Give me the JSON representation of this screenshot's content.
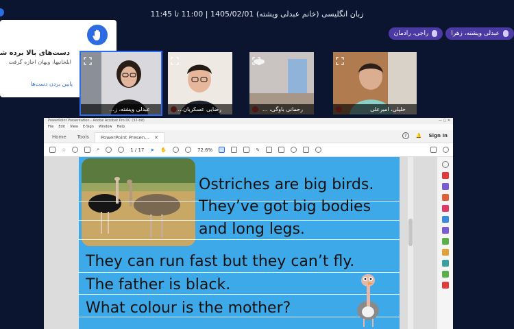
{
  "header": {
    "session_title": "زبان انگلیسی (خانم عبدلی ویشته) 1405/02/01 | 11:00 تا 11:45"
  },
  "raised_hands_popup": {
    "title": "دست‌های بالا برده شده",
    "names": "ابلخانیها، وبهان اجازه گرفت",
    "action": "پایین بردن دست‌ها"
  },
  "participant_chips": [
    {
      "name": "راجی، رادمان"
    },
    {
      "name": "عبدلی ویشته، زهرا"
    }
  ],
  "video_tiles": [
    {
      "name": "عبدلی ویشته، ز..."
    },
    {
      "name": "رضایی عسکریان..."
    },
    {
      "name": "رحمانی باوگی، ..."
    },
    {
      "name": "خلیلی، امیرعلی"
    }
  ],
  "pdf_window": {
    "title": "PowerPoint Presentation - Adobe Acrobat Pro DC (32-bit)",
    "menus": [
      "File",
      "Edit",
      "View",
      "E-Sign",
      "Window",
      "Help"
    ],
    "tabs": {
      "home": "Home",
      "tools": "Tools",
      "document": "PowerPoint Presen..."
    },
    "signin": "Sign In",
    "help_icon": "?",
    "page_indicator": "1 / 17",
    "zoom": "72.6%"
  },
  "slide": {
    "lines": [
      "Ostriches are big birds.",
      "They’ve got big bodies",
      "and long legs.",
      "They can run fast but they can’t fly.",
      "The father is black.",
      "What colour is the mother?"
    ]
  },
  "colors": {
    "background": "#0b1530",
    "accent": "#2a6cf0",
    "chip": "#4b3aa3",
    "slide_bg": "#3ea9e8"
  }
}
